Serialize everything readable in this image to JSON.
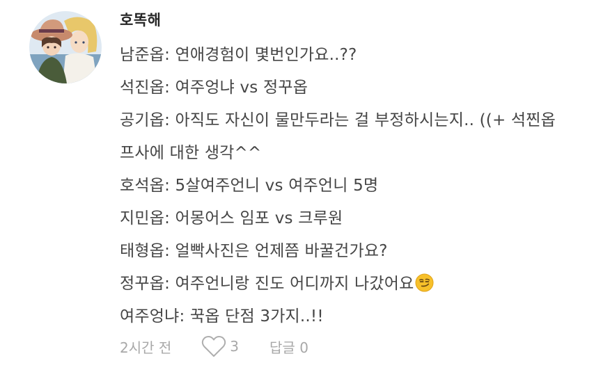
{
  "comment": {
    "author": "호똑해",
    "avatar_icon": "anime-couple-avatar",
    "lines": [
      "남준옵: 연애경험이 몇번인가요..??",
      "석진옵: 여주엉냐 vs 정꾸옵",
      "공기옵: 아직도 자신이 물만두라는 걸 부정하시는지.. ((+ 석찐옵",
      "프사에 대한 생각^^",
      "호석옵: 5살여주언니 vs 여주언니 5명",
      "지민옵: 어몽어스 임포 vs 크루원",
      "태형옵: 얼빡사진은 언제쯤 바꿀건가요?",
      "정꾸옵: 여주언니랑 진도 어디까지 나갔어요",
      "여주엉냐: 꾹옵 단점 3가지..!!"
    ],
    "emoji_icon": "smirking-face-emoji",
    "footer": {
      "time": "2시간 전",
      "like_icon": "heart-outline-icon",
      "like_count": "3",
      "reply_label": "답글 0"
    }
  }
}
